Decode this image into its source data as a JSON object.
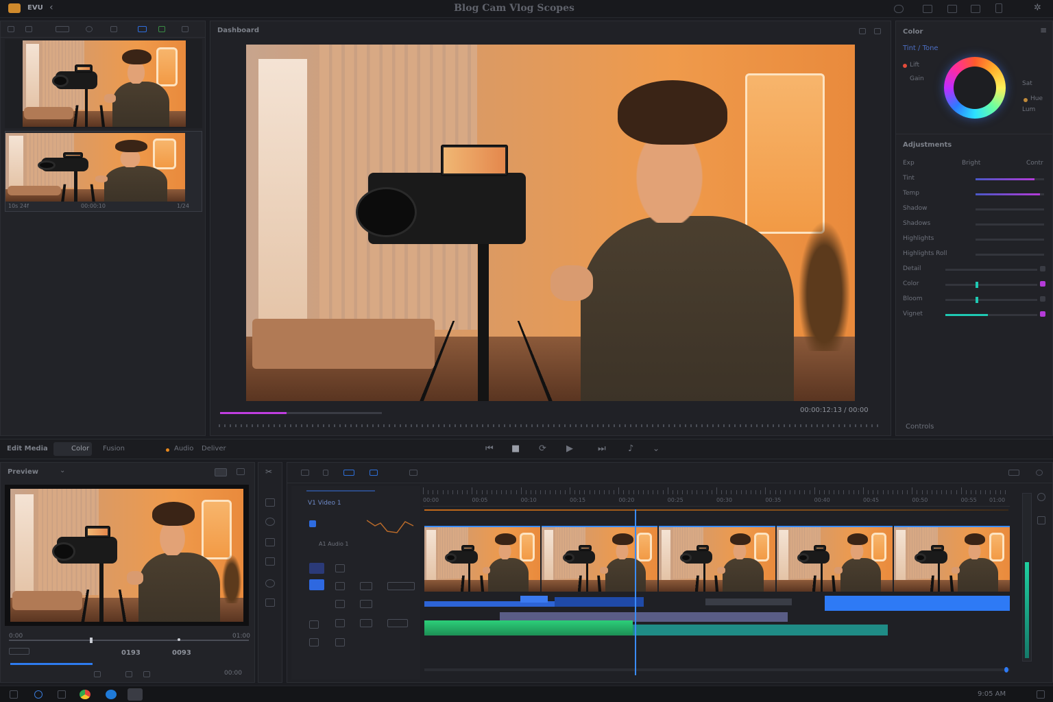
{
  "app": {
    "title": "Blog Cam Vlog Scopes",
    "logo_label": "EVU"
  },
  "media_pool": {
    "clips": [
      {
        "name": "clip_01",
        "caption_left": "",
        "caption_mid": "",
        "caption_right": ""
      },
      {
        "name": "clip_02",
        "caption_left": "10s 24f",
        "caption_mid": "00:00:10",
        "caption_right": "1/24"
      }
    ]
  },
  "viewer": {
    "label": "Dashboard",
    "timecode": "00:00:12:13 / 00:00",
    "progress": 0.41
  },
  "color_panel": {
    "title": "Color",
    "wheel_label": "Tint / Tone",
    "left_items": [
      "Lift",
      "Gain"
    ],
    "right_items": [
      "Sat",
      "Hue",
      "Lum"
    ],
    "adjust_title": "Adjustments",
    "columns": [
      "Exp",
      "Bright",
      "Contr"
    ],
    "rows": [
      "Tint",
      "Temp",
      "Shadow",
      "Shadows",
      "Highlights",
      "Highlights Roll",
      "Detail",
      "Color",
      "Bloom",
      "Vignet"
    ],
    "footer": "Controls",
    "accents": {
      "purple": "#b43bd8",
      "teal": "#1fc9b3"
    }
  },
  "toolbar": {
    "tabs": [
      "Edit Media",
      "Color",
      "Fusion",
      "Audio",
      "Deliver"
    ],
    "active_tab": "Color"
  },
  "preview_panel": {
    "title": "Preview",
    "timecode_in": "0:00",
    "timecode_out": "01:00",
    "tc_a": "0193",
    "tc_b": "0093",
    "footer_right": "00:00"
  },
  "timeline": {
    "track_label": "V1 Video 1",
    "track_label_2": "A1 Audio 1",
    "ruler_ticks": [
      "00:00",
      "00:05",
      "00:10",
      "00:15",
      "00:20",
      "00:25",
      "00:30",
      "00:35",
      "00:40",
      "00:45",
      "00:50",
      "00:55",
      "01:00"
    ],
    "playhead_fraction": 0.36
  },
  "taskbar": {
    "clock": "9:05 AM"
  }
}
